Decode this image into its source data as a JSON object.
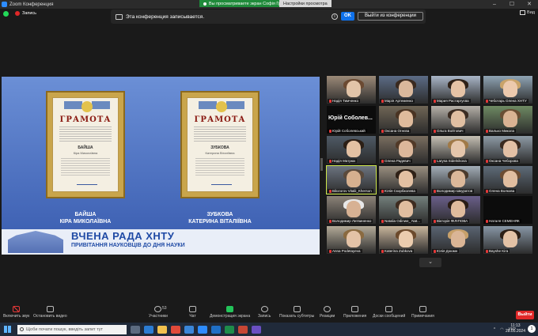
{
  "window": {
    "title": "Zoom Конференция",
    "share_banner": "Вы просматриваете экран Софія Греша",
    "view_options": "Настройки просмотра",
    "view_label": "Вид"
  },
  "topbar": {
    "recording": "Запись"
  },
  "record_notice": {
    "text": "Эта конференция записывается.",
    "info": "i",
    "ok": "OK",
    "leave": "Выйти из конференции"
  },
  "share": {
    "cert_title": "ГРАМОТА",
    "cert1": {
      "name_small": "БАЙША",
      "first_small": "Кіра Миколаївна",
      "caption_last": "БАЙША",
      "caption_first": "КІРА МИКОЛАЇВНА"
    },
    "cert2": {
      "name_small": "ЗУБКОВА",
      "first_small": "Катерина Віталіївна",
      "caption_last": "ЗУБКОВА",
      "caption_first": "КАТЕРИНА ВІТАЛІЇВНА"
    },
    "banner_title": "ВЧЕНА РАДА ХНТУ",
    "banner_subtitle": "ПРИВІТАННЯ НАУКОВЦІВ ДО ДНЯ НАУКИ"
  },
  "gallery": [
    {
      "name": "Надія Тимченко",
      "style": "f1"
    },
    {
      "name": "Марія Артеменко",
      "style": "f2"
    },
    {
      "name": "Мария Растаргуєва",
      "style": "f3"
    },
    {
      "name": "Чеботарь Олена ХНТУ",
      "style": "f4"
    },
    {
      "name": "Юрій Соболевський",
      "style": "black",
      "bigname": "Юрій Соболев..."
    },
    {
      "name": "Оксана Огнєва",
      "style": "f5"
    },
    {
      "name": "Ольга Войтович",
      "style": "f6"
    },
    {
      "name": "Валько Микола",
      "style": "f7"
    },
    {
      "name": "Надія Матрюк",
      "style": "f8"
    },
    {
      "name": "Олена Радевич",
      "style": "f9"
    },
    {
      "name": "Larysa Sidelnikova",
      "style": "f10"
    },
    {
      "name": "Оксана Чеборова",
      "style": "f11"
    },
    {
      "name": "Bilozorov Vitalii_Kherson",
      "style": "f12",
      "active": true
    },
    {
      "name": "Юлія Скорбколева",
      "style": "f13"
    },
    {
      "name": "Володимир Шкуратов",
      "style": "f14"
    },
    {
      "name": "Олена Волкова",
      "style": "f15"
    },
    {
      "name": "Володимир Литвиненко",
      "style": "f16"
    },
    {
      "name": "Natalia Odinwe_ Nat...",
      "style": "f17"
    },
    {
      "name": "Вікторія ФІЛІПОВА",
      "style": "f18"
    },
    {
      "name": "Наталя СЕМЕНЯК",
      "style": "black"
    },
    {
      "name": "Anna Podetayeva",
      "style": "f19"
    },
    {
      "name": "Katerina Zubkova",
      "style": "f20"
    },
    {
      "name": "Юлія Доюмн",
      "style": "f21"
    },
    {
      "name": "Bayshe Kira",
      "style": "f22"
    }
  ],
  "toolbar": {
    "mute": "Включить звук",
    "video": "Остановить видео",
    "participants": "Участники",
    "participants_count": "53",
    "chat": "Чат",
    "share": "Демонстрация экрана",
    "record": "Запись",
    "subtitles": "Показать субтитры",
    "reactions": "Реакции",
    "apps": "Приложения",
    "whiteboards": "Доски сообщений",
    "notes": "Примечания",
    "end": "Выйти"
  },
  "taskbar": {
    "search_placeholder": "Щоби почати пошук, введіть запит тут",
    "lang": "УКР",
    "time": "11:13",
    "date": "28.05.2024",
    "notif_count": "1"
  },
  "colors": {
    "accent": "#0e71eb",
    "end": "#e02828",
    "recording": "#e02828"
  }
}
